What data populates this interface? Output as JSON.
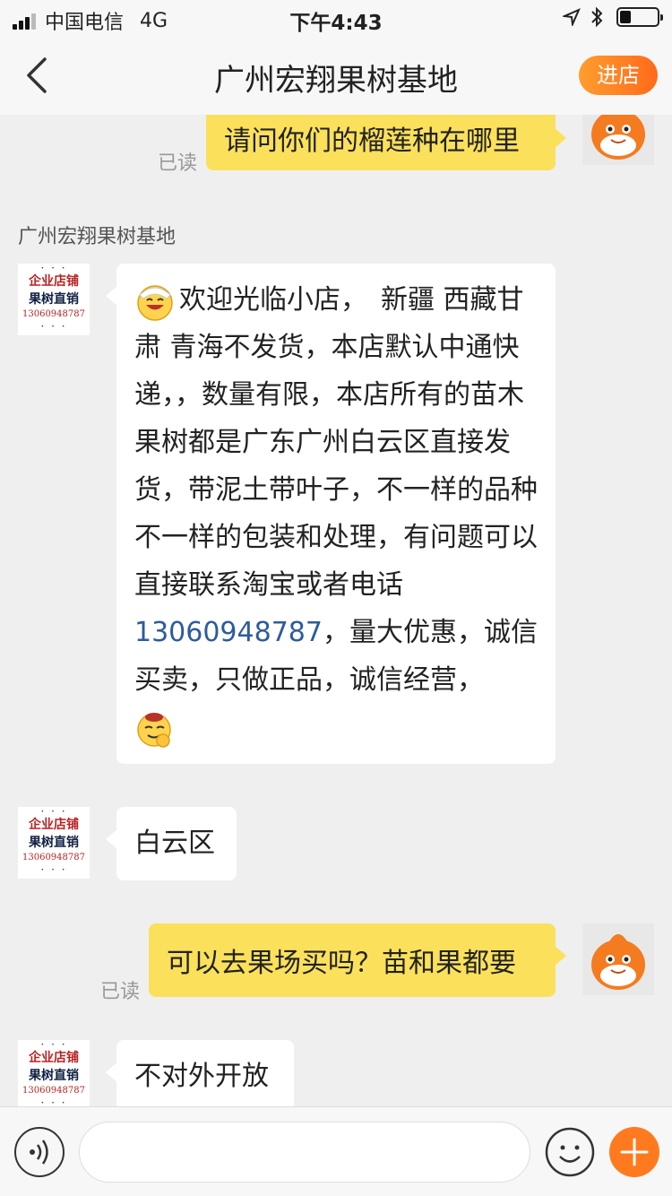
{
  "status_bar": {
    "carrier": "中国电信",
    "network": "4G",
    "time": "下午4:43"
  },
  "nav": {
    "title": "广州宏翔果树基地",
    "enter_shop": "进店"
  },
  "shop_avatar": {
    "line1": "·  ·  ·",
    "line2": "企业店铺",
    "line3": "果树直销",
    "line4": "13060948787",
    "line5": "· · ·"
  },
  "messages": {
    "m1": {
      "text": "请问你们的榴莲种在哪里",
      "status": "已读"
    },
    "sender_name": "广州宏翔果树基地",
    "m2": {
      "part1": "欢迎光临小店，　新疆 西藏甘肃 青海不发货，本店默认中通快递，，数量有限，本店所有的苗木果树都是广东广州白云区直接发货，带泥土带叶子，不一样的品种不一样的包装和处理，有问题可以直接联系淘宝或者电话",
      "phone": "13060948787",
      "part2": "，量大优惠，诚信买卖，只做正品，诚信经营，"
    },
    "m3": {
      "text": "白云区"
    },
    "m4": {
      "text": "可以去果场买吗？苗和果都要",
      "status": "已读"
    },
    "m5": {
      "text": "不对外开放"
    }
  },
  "input": {
    "placeholder": ""
  },
  "colors": {
    "accent": "#ff7a1f",
    "my_bubble": "#fbe05b",
    "link": "#2d5b9e"
  }
}
